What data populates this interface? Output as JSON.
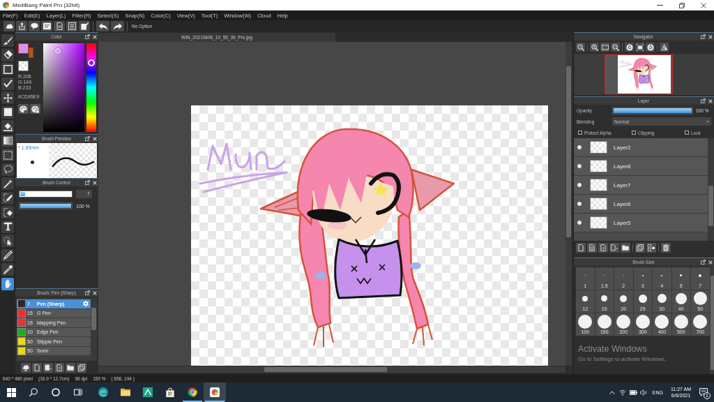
{
  "window": {
    "title": "MediBang Paint Pro (32bit)"
  },
  "menu": [
    "File(F)",
    "Edit(E)",
    "Layer(L)",
    "Filter(R)",
    "Select(S)",
    "Snap(N)",
    "Color(C)",
    "View(V)",
    "Tool(T)",
    "Window(W)",
    "Cloud",
    "Help"
  ],
  "toolbar": {
    "option_text": "No Option"
  },
  "tools": [
    {
      "selected": false
    },
    {
      "selected": false
    },
    {
      "selected": false
    },
    {
      "selected": false
    },
    {
      "selected": false
    },
    {
      "selected": false
    },
    {
      "selected": false
    },
    {
      "selected": false
    },
    {
      "selected": false
    },
    {
      "selected": false
    },
    {
      "selected": false
    },
    {
      "selected": false
    },
    {
      "selected": false
    },
    {
      "selected": false
    },
    {
      "selected": false
    },
    {
      "selected": false
    },
    {
      "selected": false
    },
    {
      "selected": true
    }
  ],
  "color_panel": {
    "title": "Color",
    "swatches": [
      {
        "color": "#cd95e9",
        "selected": true
      },
      {
        "color": "#b8540e",
        "selected": false
      }
    ],
    "channels": [
      "R:205",
      "G:149",
      "B:233"
    ],
    "hex": "#CD95E9"
  },
  "brush_preview": {
    "title": "Brush Preview",
    "size": "* 1.85mm"
  },
  "brush_control": {
    "title": "Brush Control",
    "sliders": [
      {
        "kind": "spinbox",
        "level": 0.1,
        "reading": "7"
      },
      {
        "kind": "percent",
        "level": 1,
        "reading": "100 %"
      }
    ]
  },
  "brush_list": {
    "title": "Brush: Pen (Sharp)",
    "items": [
      {
        "size": "7",
        "name": "Pen (Sharp)",
        "color": "#2a2a2a",
        "selected": true
      },
      {
        "size": "15",
        "name": "G Pen",
        "color": "#e53232",
        "selected": false
      },
      {
        "size": "15",
        "name": "Mapping Pen",
        "color": "#e53232",
        "selected": false
      },
      {
        "size": "10",
        "name": "Edge Pen",
        "color": "#22a822",
        "selected": false
      },
      {
        "size": "50",
        "name": "Stipple Pen",
        "color": "#e6d81c",
        "selected": false
      },
      {
        "size": "50",
        "name": "Sumi",
        "color": "#e6d81c",
        "selected": false
      }
    ]
  },
  "document": {
    "tab": "WIN_20210606_10_55_39_Pro.jpg"
  },
  "navigator": {
    "title": "Navigator"
  },
  "layer_panel": {
    "title": "Layer",
    "opacity": {
      "label": "Opacity",
      "level": 1,
      "reading": "100 %"
    },
    "blending": {
      "label": "Blending",
      "value": "Normal"
    },
    "options": [
      {
        "label": "Protect Alpha",
        "checked": false
      },
      {
        "label": "Clipping",
        "checked": false
      },
      {
        "label": "Lock",
        "checked": false
      }
    ],
    "layers": [
      {
        "name": "Layer2",
        "visible": true
      },
      {
        "name": "Layer8",
        "visible": true
      },
      {
        "name": "Layer7",
        "visible": true
      },
      {
        "name": "Layer6",
        "visible": true
      },
      {
        "name": "Layer5",
        "visible": true
      }
    ]
  },
  "brush_size": {
    "title": "Brush Size",
    "sizes": [
      "1",
      "1.5",
      "2",
      "3",
      "4",
      "5",
      "7",
      "12",
      "15",
      "20",
      "25",
      "30",
      "40",
      "50",
      "100",
      "150",
      "200",
      "300",
      "400",
      "500",
      "700"
    ]
  },
  "activation_notice": {
    "title": "Activate Windows",
    "message": "Go to Settings to activate Windows."
  },
  "status_bar": {
    "items": [
      "640 * 480 pixel",
      "(16.9 * 12.7cm)",
      "96 dpi",
      "150 %",
      "( 656, 194 )"
    ]
  },
  "taskbar": {
    "apps": [
      {
        "running": false,
        "selected": false
      },
      {
        "running": false,
        "selected": false
      },
      {
        "running": false,
        "selected": false
      },
      {
        "running": false,
        "selected": false
      },
      {
        "running": true,
        "selected": false
      },
      {
        "running": true,
        "selected": true
      }
    ],
    "language": "ENG",
    "time": "11:27 AM",
    "date": "6/6/2021",
    "notification_count": "1"
  }
}
